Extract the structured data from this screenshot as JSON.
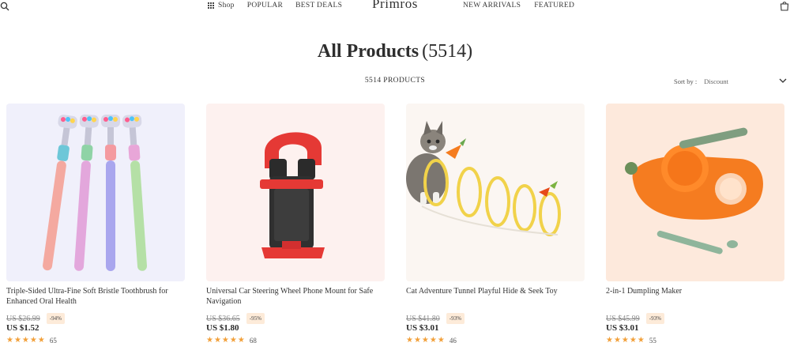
{
  "header": {
    "logo": "Primros",
    "nav_left": [
      "Shop",
      "POPULAR",
      "BEST DEALS"
    ],
    "nav_right": [
      "NEW ARRIVALS",
      "FEATURED"
    ],
    "icons": [
      "search-icon",
      "grid-icon",
      "shopping-bag-icon"
    ]
  },
  "page": {
    "title": "All Products",
    "title_count": "(5514)",
    "product_count": "5514 PRODUCTS",
    "sort_label": "Sort by :",
    "sort_value": "Discount"
  },
  "products": [
    {
      "name": "Triple-Sided Ultra-Fine Soft Bristle Toothbrush for Enhanced Oral Health",
      "old_price": "US $26.99",
      "discount": "-94%",
      "price": "US $1.52",
      "stars": "★★★★★",
      "reviews": "65"
    },
    {
      "name": "Universal Car Steering Wheel Phone Mount for Safe Navigation",
      "old_price": "US $36.65",
      "discount": "-95%",
      "price": "US $1.80",
      "stars": "★★★★★",
      "reviews": "68"
    },
    {
      "name": "Cat Adventure Tunnel Playful Hide & Seek Toy",
      "old_price": "US $41.80",
      "discount": "-93%",
      "price": "US $3.01",
      "stars": "★★★★★",
      "reviews": "46"
    },
    {
      "name": "2-in-1 Dumpling Maker",
      "old_price": "US $45.99",
      "discount": "-93%",
      "price": "US $3.01",
      "stars": "★★★★★",
      "reviews": "55"
    }
  ],
  "colors": {
    "badge_bg": "#fdebd9",
    "star": "#f2a03a",
    "text": "#2b2b2b"
  }
}
